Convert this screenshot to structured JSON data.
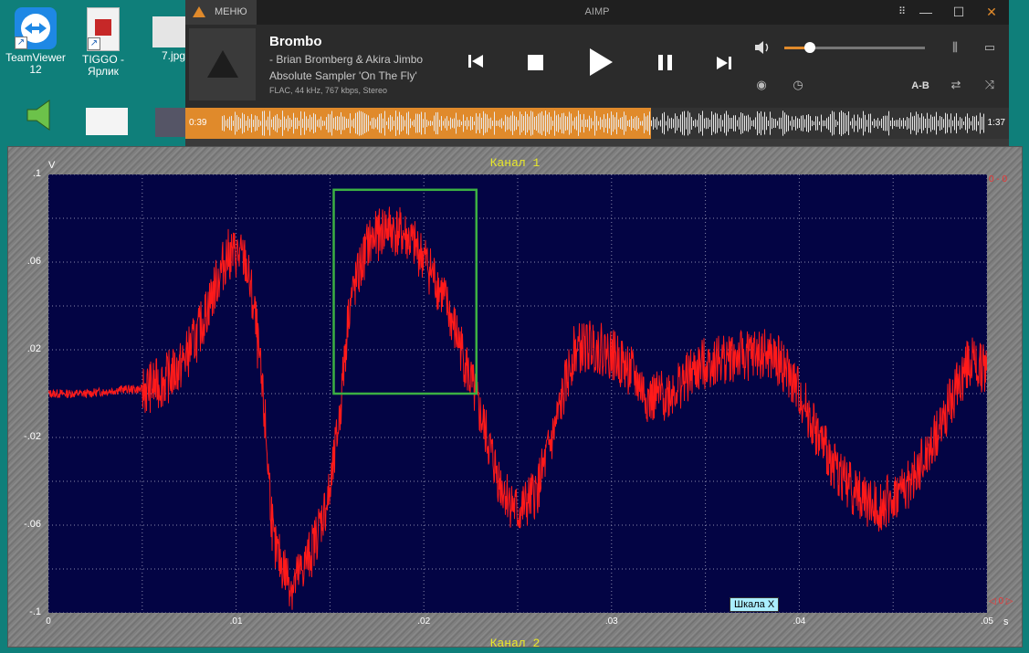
{
  "desktop": {
    "icons": [
      {
        "label": "TeamViewer\n12",
        "name": "teamviewer"
      },
      {
        "label": "TIGGO -\nЯрлик",
        "name": "tiggo"
      },
      {
        "label": "7.jpg",
        "name": "7-jpg"
      }
    ]
  },
  "aimp": {
    "menu_label": "МЕНЮ",
    "app_title": "AIMP",
    "track": {
      "title": "Brombo",
      "artist": "- Brian Bromberg & Akira Jimbo",
      "album": "Absolute Sampler 'On The Fly'",
      "info": "FLAC, 44 kHz, 767 kbps, Stereo"
    },
    "time_elapsed": "0:39",
    "time_total": "1:37",
    "progress": 0.404,
    "volume": 0.18,
    "ab_label": "A-B",
    "colors": {
      "accent": "#e08a2b",
      "background": "#2b2b2b"
    }
  },
  "scope": {
    "channel_title": "Канал 1",
    "channel2_title": "Канал 2",
    "unit_y": "V",
    "unit_x": "s",
    "scale_button": "Шкала X",
    "marker_top": "0 - 0",
    "marker_bottom": "◁ 0 ▷",
    "colors": {
      "background": "#030444",
      "trace": "#ff1a1a",
      "selection": "#3cb043",
      "grid": "#8888aa"
    }
  },
  "chart_data": {
    "type": "line",
    "title": "Канал 1",
    "xlabel": "s",
    "ylabel": "V",
    "xlim": [
      0,
      0.05
    ],
    "ylim": [
      -0.1,
      0.1
    ],
    "x_ticks": [
      "0",
      ".01",
      ".02",
      ".03",
      ".04",
      ".05"
    ],
    "y_ticks": [
      ".1",
      ".06",
      ".02",
      "-.02",
      "-.06",
      "-.1"
    ],
    "grid": true,
    "selection": {
      "x": [
        0.0152,
        0.0228
      ],
      "y": [
        0.0,
        0.093
      ]
    },
    "series": [
      {
        "x": [
          0,
          0.002,
          0.004,
          0.005,
          0.006,
          0.007,
          0.008,
          0.009,
          0.0095,
          0.01,
          0.0105,
          0.011,
          0.0115,
          0.012,
          0.013,
          0.014,
          0.015,
          0.0155,
          0.016,
          0.017,
          0.018,
          0.019,
          0.02,
          0.021,
          0.022,
          0.023,
          0.024,
          0.025,
          0.026,
          0.027,
          0.028,
          0.029,
          0.03,
          0.031,
          0.032,
          0.033,
          0.034,
          0.035,
          0.036,
          0.037,
          0.038,
          0.039,
          0.04,
          0.041,
          0.042,
          0.043,
          0.044,
          0.045,
          0.046,
          0.047,
          0.048,
          0.049,
          0.05
        ],
        "y": [
          0.0,
          0.0,
          0.002,
          0.002,
          0.005,
          0.012,
          0.028,
          0.052,
          0.063,
          0.064,
          0.06,
          0.035,
          -0.01,
          -0.07,
          -0.088,
          -0.072,
          -0.045,
          -0.01,
          0.04,
          0.068,
          0.076,
          0.072,
          0.062,
          0.045,
          0.02,
          -0.01,
          -0.04,
          -0.055,
          -0.045,
          -0.015,
          0.02,
          0.022,
          0.018,
          0.01,
          -0.003,
          0.0,
          0.007,
          0.014,
          0.016,
          0.017,
          0.018,
          0.014,
          0.0,
          -0.02,
          -0.035,
          -0.045,
          -0.052,
          -0.048,
          -0.04,
          -0.025,
          -0.005,
          0.015,
          0.01
        ]
      }
    ]
  }
}
